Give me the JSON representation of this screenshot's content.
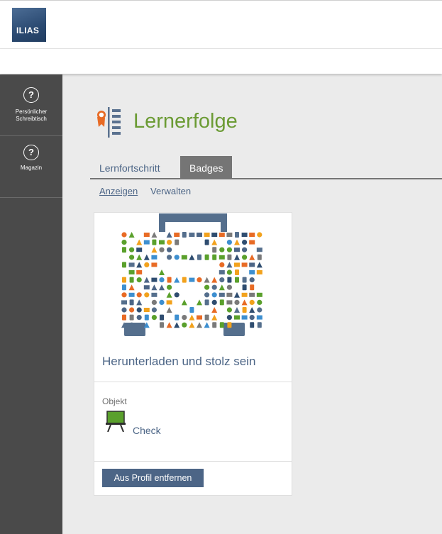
{
  "brand": {
    "logo_text": "ILIAS"
  },
  "mainbar": {
    "items": [
      {
        "label_line1": "Persönlicher",
        "label_line2": "Schreibtisch",
        "icon": "question-circle-icon"
      },
      {
        "label_line1": "Magazin",
        "icon": "question-circle-icon"
      }
    ]
  },
  "page": {
    "title": "Lernerfolge"
  },
  "tabs": [
    {
      "label": "Lernfortschritt",
      "active": false
    },
    {
      "label": "Badges",
      "active": true
    }
  ],
  "subtabs": [
    {
      "label": "Anzeigen",
      "active": true
    },
    {
      "label": "Verwalten",
      "active": false
    }
  ],
  "badge_card": {
    "title": "Herunterladen und stolz sein",
    "property_label": "Objekt",
    "object_name": "Check",
    "object_icon": "easel-board-icon",
    "remove_button": "Aus Profil entfernen"
  },
  "colors": {
    "link": "#4c6586",
    "title_green": "#6b9b34",
    "mainbar": "#4a4a4a",
    "tab_active": "#757575",
    "award_orange": "#e86b25"
  }
}
